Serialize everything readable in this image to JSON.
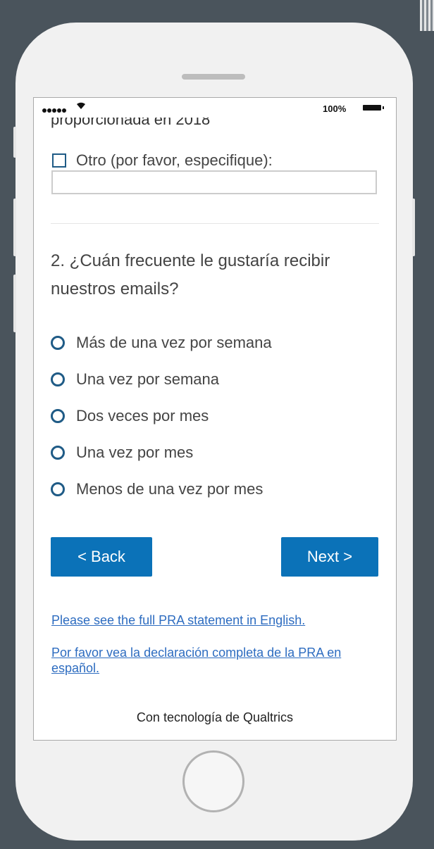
{
  "status_bar": {
    "battery_percent": "100%"
  },
  "previous_question": {
    "partial_text": "proporcionada en 2018"
  },
  "other_option": {
    "label": "Otro (por favor, especifique):",
    "input_value": ""
  },
  "question2": {
    "text": "2. ¿Cuán frecuente le gustaría recibir nuestros emails?",
    "options": [
      "Más de una vez por semana",
      "Una vez por semana",
      "Dos veces por mes",
      "Una vez por mes",
      "Menos de una vez por mes"
    ]
  },
  "navigation": {
    "back_label": "< Back",
    "next_label": "Next >"
  },
  "links": {
    "pra_english": "Please see the full PRA statement in English.",
    "pra_spanish": "Por favor vea la declaración completa de la PRA en español."
  },
  "footer": {
    "powered_by": "Con tecnología de Qualtrics"
  },
  "colors": {
    "accent": "#0b72b8",
    "control_border": "#1f5b86",
    "link": "#2d6cc0",
    "background": "#4a545c"
  }
}
